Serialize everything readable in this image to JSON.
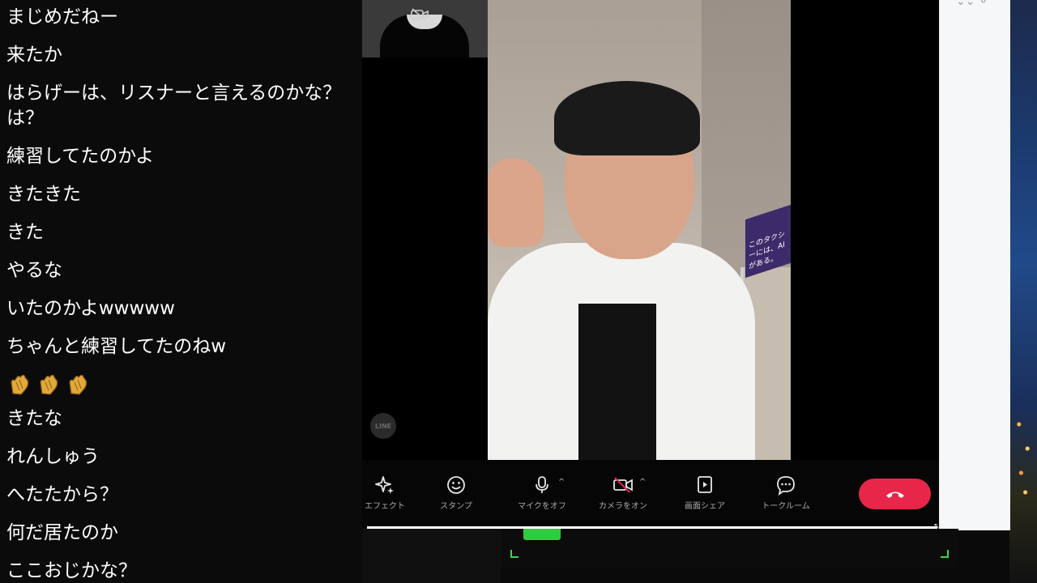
{
  "chat": {
    "messages": [
      "まじめだねー",
      "来たか",
      "はらげーは、リスナーと言えるのかな？\nは？",
      "練習してたのかよ",
      "きたきた",
      "きた",
      "やるな",
      "いたのかよwwwww",
      "ちゃんと練習してたのねw",
      "きたな",
      "れんしゅう",
      "へたたから？",
      "何だ居たのか",
      "ここおじかな？"
    ],
    "emoji_row": [
      "clap-hands",
      "clap-hands",
      "clap-hands"
    ]
  },
  "call": {
    "watermark": "LINE",
    "poster_text": "このタクシーには、AIがある。"
  },
  "toolbar": {
    "effect_label": "エフェクト",
    "stamp_label": "スタンプ",
    "mic_label": "マイクをオフ",
    "camera_label": "カメラをオン",
    "share_label": "画面シェア",
    "talk_label": "トークルーム",
    "caret": "^"
  },
  "colors": {
    "end_call": "#e8264a",
    "accent_green": "#3cd64a"
  }
}
